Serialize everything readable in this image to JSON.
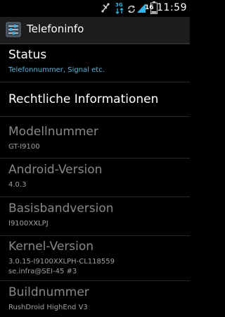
{
  "status_bar": {
    "time": "11:59",
    "battery_level": "16",
    "network_type": "3G",
    "icons": [
      "usb-debug-icon",
      "network-3g-icon",
      "sync-icon",
      "signal-icon",
      "battery-icon"
    ]
  },
  "action_bar": {
    "title": "Telefoninfo",
    "icon": "settings-sliders-icon"
  },
  "items": [
    {
      "title": "Status",
      "summary": "Telefonnummer, Signal etc."
    },
    {
      "title": "Rechtliche Informationen"
    },
    {
      "title": "Modellnummer",
      "summary": "GT-I9100"
    },
    {
      "title": "Android-Version",
      "summary": "4.0.3"
    },
    {
      "title": "Basisbandversion",
      "summary": "I9100XXLPJ"
    },
    {
      "title": "Kernel-Version",
      "summary_line1": "3.0.15-I9100XXLPH-CL118559",
      "summary_line2": "se.infra@SEI-45 #3"
    },
    {
      "title": "Buildnummer",
      "summary": "RushDroid HighEnd V3"
    }
  ],
  "colors": {
    "accent": "#59b5dd",
    "disabled_text": "#888888",
    "background": "#000000",
    "action_bar": "#1c1c1c"
  }
}
